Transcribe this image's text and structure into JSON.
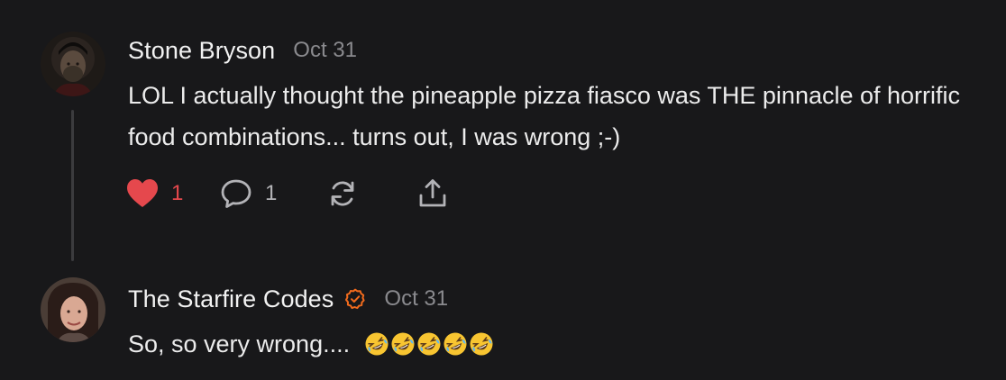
{
  "comments": [
    {
      "author": "Stone Bryson",
      "date": "Oct 31",
      "text": "LOL I actually thought the pineapple pizza fiasco was THE pinnacle of horrific food combinations... turns out, I was wrong ;-)",
      "like_count": "1",
      "reply_count": "1",
      "liked": true
    },
    {
      "author": "The Starfire Codes",
      "verified": true,
      "date": "Oct 31",
      "text": "So, so very wrong....",
      "emojis": [
        "rolling-on-floor-laughing",
        "rolling-on-floor-laughing",
        "rolling-on-floor-laughing",
        "rolling-on-floor-laughing",
        "rolling-on-floor-laughing"
      ]
    }
  ],
  "icons": {
    "like": "heart-icon",
    "reply": "comment-bubble-icon",
    "restack": "restack-icon",
    "share": "share-icon",
    "verified": "verified-badge-icon"
  },
  "colors": {
    "background": "#18181a",
    "like_active": "#e5484d",
    "verified_badge": "#f26b1d",
    "muted_text": "#8a8a8e"
  }
}
